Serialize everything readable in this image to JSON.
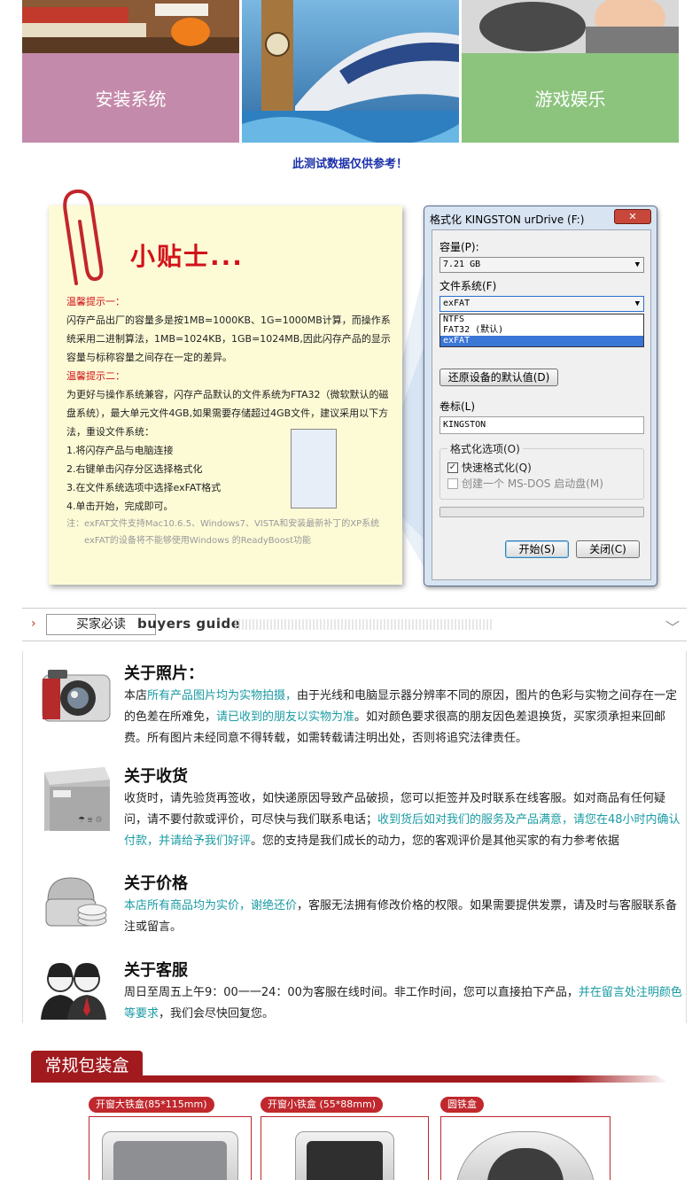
{
  "banner": {
    "tiles": [
      {
        "caption": "安装系统"
      },
      {
        "caption": ""
      },
      {
        "caption": "游戏娱乐"
      }
    ],
    "notice": "此测试数据仅供参考！"
  },
  "tips": {
    "title": "小贴士...",
    "tip1_heading": "温馨提示一：",
    "tip1_text": "闪存产品出厂的容量多是按1MB=1000KB、1G=1000MB计算，而操作系统采用二进制算法，1MB=1024KB，1GB=1024MB,因此闪存产品的显示容量与标称容量之间存在一定的差异。",
    "tip2_heading": "温馨提示二：",
    "tip2_text": "为更好与操作系统兼容，闪存产品默认的文件系统为FTA32（微软默认的磁盘系统），最大单元文件4GB,如果需要存储超过4GB文件，建议采用以下方法，重设文件系统：",
    "steps": [
      "1.将闪存产品与电脑连接",
      "2.右键单击闪存分区选择格式化",
      "3.在文件系统选项中选择exFAT格式",
      "4.单击开始，完成即可。"
    ],
    "note_line1": "注：exFAT文件支持Mac10.6.5、Windows7、VISTA和安装最新补丁的XP系统",
    "note_line2": "exFAT的设备将不能够使用Windows 的ReadyBoost功能"
  },
  "dialog": {
    "title": "格式化 KINGSTON urDrive (F:)",
    "close_label": "✕",
    "capacity_label": "容量(P):",
    "capacity_value": "7.21 GB",
    "fs_label": "文件系统(F)",
    "fs_value": "exFAT",
    "fs_options": [
      "NTFS",
      "FAT32 (默认)",
      "exFAT"
    ],
    "restore_label": "还原设备的默认值(D)",
    "volume_label": "卷标(L)",
    "volume_value": "KINGSTON",
    "format_options_label": "格式化选项(O)",
    "quick_format_label": "快速格式化(Q)",
    "msdos_label": "创建一个 MS-DOS 启动盘(M)",
    "start_label": "开始(S)",
    "close_button_label": "关闭(C)"
  },
  "guide": {
    "cn": "买家必读",
    "en": "buyers guide",
    "sections": [
      {
        "title": "关于照片：",
        "parts": [
          "本店",
          "所有产品图片均为实物拍摄，",
          "由于光线和电脑显示器分辨率不同的原因，图片的色彩与实物之间存在一定的色差在所难免，",
          "请已收到的朋友以实物为准",
          "。如对颜色要求很高的朋友因色差退换货，买家须承担来回邮费。所有图片未经同意不得转载，如需转载请注明出处，否则将追究法律责任。"
        ]
      },
      {
        "title": "关于收货",
        "parts": [
          "收货时，请先验货再签收，如快递原因导致产品破损，您可以拒签并及时联系在线客服。如对商品有任何疑问，请不要付款或评价，可尽快与我们联系电话；",
          "收到货后如对我们的服务及产品满意，请您在48小时内确认付款，并请给予我们好评",
          "。您的支持是我们成长的动力，您的客观评价是其他买家的有力参考依据"
        ]
      },
      {
        "title": "关于价格",
        "parts": [
          "本店所有商品均为实价，谢绝还价",
          "，客服无法拥有修改价格的权限。如果需要提供发票，请及时与客服联系备注或留言。"
        ]
      },
      {
        "title": "关于客服",
        "parts": [
          "周日至周五上午9：00一一24：00为客服在线时间。非工作时间，您可以直接拍下产品，",
          "并在留言处注明颜色等要求",
          "，我们会尽快回复您。"
        ]
      }
    ]
  },
  "packaging": {
    "title": "常规包装盒",
    "items": [
      {
        "label": "开窗大铁盒(85*115mm)"
      },
      {
        "label": "开窗小铁盒 (55*88mm)"
      },
      {
        "label": "圆铁盒"
      }
    ]
  },
  "colors": {
    "accent_red": "#a11a1e",
    "highlight_teal": "#1a9ba3",
    "notice_blue": "#1a2fa8"
  }
}
